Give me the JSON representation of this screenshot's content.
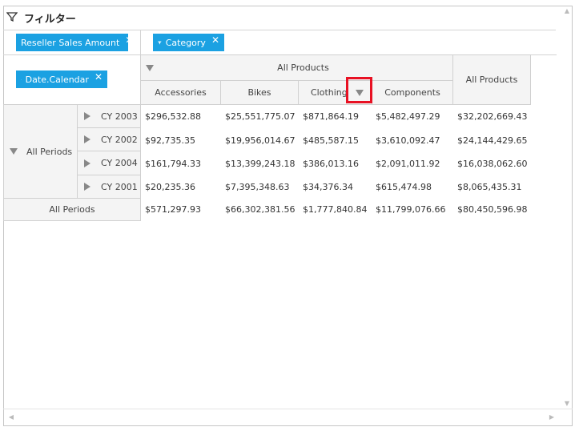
{
  "filter_bar": {
    "title": "フィルター"
  },
  "chips": {
    "values": {
      "label": "Reseller Sales Amount"
    },
    "columns": {
      "label": "Category"
    },
    "rows": {
      "label": "Date.Calendar"
    }
  },
  "grid": {
    "column_group_header": "All Products",
    "columns": [
      "Accessories",
      "Bikes",
      "Clothing",
      "Components"
    ],
    "grand_total_header": "All Products",
    "row_group_header": "All Periods",
    "rows": [
      {
        "label": "CY 2003",
        "values": [
          "$296,532.88",
          "$25,551,775.07",
          "$871,864.19",
          "$5,482,497.29",
          "$32,202,669.43"
        ]
      },
      {
        "label": "CY 2002",
        "values": [
          "$92,735.35",
          "$19,956,014.67",
          "$485,587.15",
          "$3,610,092.47",
          "$24,144,429.65"
        ]
      },
      {
        "label": "CY 2004",
        "values": [
          "$161,794.33",
          "$13,399,243.18",
          "$386,013.16",
          "$2,091,011.92",
          "$16,038,062.60"
        ]
      },
      {
        "label": "CY 2001",
        "values": [
          "$20,235.36",
          "$7,395,348.63",
          "$34,376.34",
          "$615,474.98",
          "$8,065,435.31"
        ]
      }
    ],
    "total_row": {
      "label": "All Periods",
      "values": [
        "$571,297.93",
        "$66,302,381.56",
        "$1,777,840.84",
        "$11,799,076.66",
        "$80,450,596.98"
      ]
    }
  },
  "colors": {
    "chip": "#1ba1e2",
    "highlight": "#e81123",
    "header_bg": "#f4f4f4"
  },
  "icons": [
    "filter-icon",
    "close-icon",
    "collapse-triangle-icon",
    "expand-triangle-icon",
    "dropdown-triangle-icon"
  ]
}
